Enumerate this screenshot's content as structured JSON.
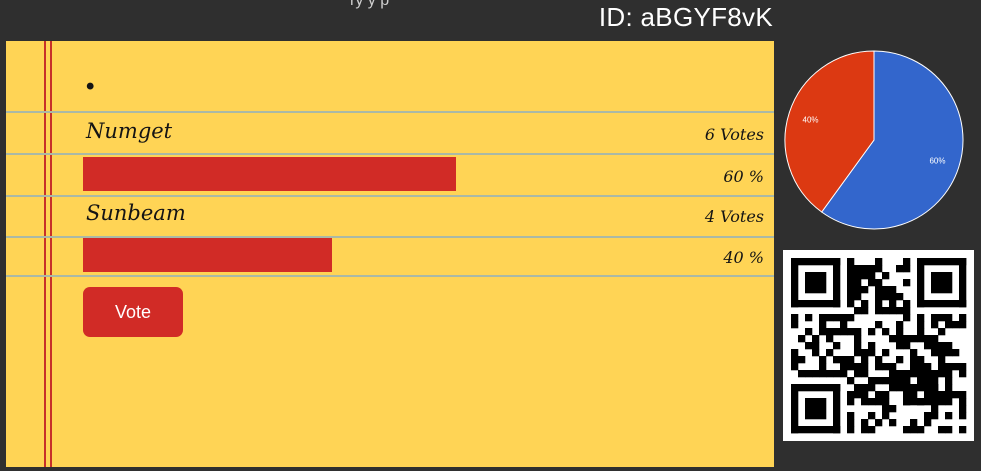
{
  "header": {
    "partial_text": "ry   y   p",
    "poll_id": "ID: aBGYF8vK"
  },
  "poll": {
    "title": "•",
    "options": [
      {
        "name": "Numget",
        "votes_label": "6 Votes",
        "percent_label": "60 %",
        "fraction": 0.6
      },
      {
        "name": "Sunbeam",
        "votes_label": "4 Votes",
        "percent_label": "40 %",
        "fraction": 0.4
      }
    ],
    "vote_button": "Vote"
  },
  "chart_data": {
    "type": "pie",
    "slices": [
      {
        "label": "Numget",
        "value": 60,
        "data_label": "60%",
        "color": "#3366cc"
      },
      {
        "label": "Sunbeam",
        "value": 40,
        "data_label": "40%",
        "color": "#dc3912"
      }
    ]
  },
  "colors": {
    "page_background": "#2f2f2f",
    "paper": "#ffd455",
    "accent_red": "#d12b26",
    "rule_line": "#aab9a6"
  },
  "qr_code": {
    "icon": "qr-code-icon"
  }
}
